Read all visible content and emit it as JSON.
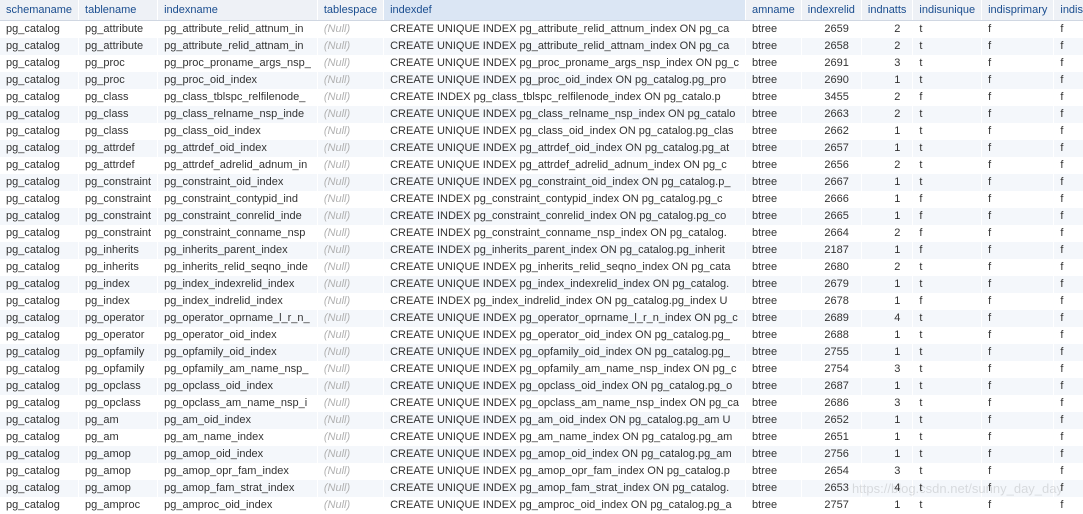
{
  "watermark": "https://blog.csdn.net/sunny_day_day",
  "columns": [
    {
      "key": "schemaname",
      "label": "schemaname",
      "sorted": false,
      "type": "text"
    },
    {
      "key": "tablename",
      "label": "tablename",
      "sorted": false,
      "type": "text"
    },
    {
      "key": "indexname",
      "label": "indexname",
      "sorted": false,
      "type": "text"
    },
    {
      "key": "tablespace",
      "label": "tablespace",
      "sorted": false,
      "type": "text"
    },
    {
      "key": "indexdef",
      "label": "indexdef",
      "sorted": true,
      "type": "text"
    },
    {
      "key": "amname",
      "label": "amname",
      "sorted": false,
      "type": "text"
    },
    {
      "key": "indexrelid",
      "label": "indexrelid",
      "sorted": false,
      "type": "num"
    },
    {
      "key": "indnatts",
      "label": "indnatts",
      "sorted": false,
      "type": "num"
    },
    {
      "key": "indisunique",
      "label": "indisunique",
      "sorted": false,
      "type": "text"
    },
    {
      "key": "indisprimary",
      "label": "indisprimary",
      "sorted": false,
      "type": "text"
    },
    {
      "key": "indisclustered",
      "label": "indisclu",
      "sorted": false,
      "type": "text"
    }
  ],
  "null_text": "(Null)",
  "rows": [
    {
      "schemaname": "pg_catalog",
      "tablename": "pg_attribute",
      "indexname": "pg_attribute_relid_attnum_in",
      "tablespace": null,
      "indexdef": "CREATE UNIQUE INDEX pg_attribute_relid_attnum_index ON pg_ca",
      "amname": "btree",
      "indexrelid": 2659,
      "indnatts": 2,
      "indisunique": "t",
      "indisprimary": "f",
      "indisclustered": "f"
    },
    {
      "schemaname": "pg_catalog",
      "tablename": "pg_attribute",
      "indexname": "pg_attribute_relid_attnam_in",
      "tablespace": null,
      "indexdef": "CREATE UNIQUE INDEX pg_attribute_relid_attnam_index ON pg_ca",
      "amname": "btree",
      "indexrelid": 2658,
      "indnatts": 2,
      "indisunique": "t",
      "indisprimary": "f",
      "indisclustered": "f"
    },
    {
      "schemaname": "pg_catalog",
      "tablename": "pg_proc",
      "indexname": "pg_proc_proname_args_nsp_",
      "tablespace": null,
      "indexdef": "CREATE UNIQUE INDEX pg_proc_proname_args_nsp_index ON pg_c",
      "amname": "btree",
      "indexrelid": 2691,
      "indnatts": 3,
      "indisunique": "t",
      "indisprimary": "f",
      "indisclustered": "f"
    },
    {
      "schemaname": "pg_catalog",
      "tablename": "pg_proc",
      "indexname": "pg_proc_oid_index",
      "tablespace": null,
      "indexdef": "CREATE UNIQUE INDEX pg_proc_oid_index ON pg_catalog.pg_pro",
      "amname": "btree",
      "indexrelid": 2690,
      "indnatts": 1,
      "indisunique": "t",
      "indisprimary": "f",
      "indisclustered": "f"
    },
    {
      "schemaname": "pg_catalog",
      "tablename": "pg_class",
      "indexname": "pg_class_tblspc_relfilenode_",
      "tablespace": null,
      "indexdef": "CREATE INDEX pg_class_tblspc_relfilenode_index ON pg_catalo.p",
      "amname": "btree",
      "indexrelid": 3455,
      "indnatts": 2,
      "indisunique": "f",
      "indisprimary": "f",
      "indisclustered": "f"
    },
    {
      "schemaname": "pg_catalog",
      "tablename": "pg_class",
      "indexname": "pg_class_relname_nsp_inde",
      "tablespace": null,
      "indexdef": "CREATE UNIQUE INDEX pg_class_relname_nsp_index ON pg_catalo",
      "amname": "btree",
      "indexrelid": 2663,
      "indnatts": 2,
      "indisunique": "t",
      "indisprimary": "f",
      "indisclustered": "f"
    },
    {
      "schemaname": "pg_catalog",
      "tablename": "pg_class",
      "indexname": "pg_class_oid_index",
      "tablespace": null,
      "indexdef": "CREATE UNIQUE INDEX pg_class_oid_index ON pg_catalog.pg_clas",
      "amname": "btree",
      "indexrelid": 2662,
      "indnatts": 1,
      "indisunique": "t",
      "indisprimary": "f",
      "indisclustered": "f"
    },
    {
      "schemaname": "pg_catalog",
      "tablename": "pg_attrdef",
      "indexname": "pg_attrdef_oid_index",
      "tablespace": null,
      "indexdef": "CREATE UNIQUE INDEX pg_attrdef_oid_index ON pg_catalog.pg_at",
      "amname": "btree",
      "indexrelid": 2657,
      "indnatts": 1,
      "indisunique": "t",
      "indisprimary": "f",
      "indisclustered": "f"
    },
    {
      "schemaname": "pg_catalog",
      "tablename": "pg_attrdef",
      "indexname": "pg_attrdef_adrelid_adnum_in",
      "tablespace": null,
      "indexdef": "CREATE UNIQUE INDEX pg_attrdef_adrelid_adnum_index ON pg_c",
      "amname": "btree",
      "indexrelid": 2656,
      "indnatts": 2,
      "indisunique": "t",
      "indisprimary": "f",
      "indisclustered": "f"
    },
    {
      "schemaname": "pg_catalog",
      "tablename": "pg_constraint",
      "indexname": "pg_constraint_oid_index",
      "tablespace": null,
      "indexdef": "CREATE UNIQUE INDEX pg_constraint_oid_index ON pg_catalog.p_",
      "amname": "btree",
      "indexrelid": 2667,
      "indnatts": 1,
      "indisunique": "t",
      "indisprimary": "f",
      "indisclustered": "f"
    },
    {
      "schemaname": "pg_catalog",
      "tablename": "pg_constraint",
      "indexname": "pg_constraint_contypid_ind",
      "tablespace": null,
      "indexdef": "CREATE INDEX pg_constraint_contypid_index ON pg_catalog.pg_c",
      "amname": "btree",
      "indexrelid": 2666,
      "indnatts": 1,
      "indisunique": "f",
      "indisprimary": "f",
      "indisclustered": "f"
    },
    {
      "schemaname": "pg_catalog",
      "tablename": "pg_constraint",
      "indexname": "pg_constraint_conrelid_inde",
      "tablespace": null,
      "indexdef": "CREATE INDEX pg_constraint_conrelid_index ON pg_catalog.pg_co",
      "amname": "btree",
      "indexrelid": 2665,
      "indnatts": 1,
      "indisunique": "f",
      "indisprimary": "f",
      "indisclustered": "f"
    },
    {
      "schemaname": "pg_catalog",
      "tablename": "pg_constraint",
      "indexname": "pg_constraint_conname_nsp",
      "tablespace": null,
      "indexdef": "CREATE INDEX pg_constraint_conname_nsp_index ON pg_catalog.",
      "amname": "btree",
      "indexrelid": 2664,
      "indnatts": 2,
      "indisunique": "f",
      "indisprimary": "f",
      "indisclustered": "f"
    },
    {
      "schemaname": "pg_catalog",
      "tablename": "pg_inherits",
      "indexname": "pg_inherits_parent_index",
      "tablespace": null,
      "indexdef": "CREATE INDEX pg_inherits_parent_index ON pg_catalog.pg_inherit",
      "amname": "btree",
      "indexrelid": 2187,
      "indnatts": 1,
      "indisunique": "f",
      "indisprimary": "f",
      "indisclustered": "f"
    },
    {
      "schemaname": "pg_catalog",
      "tablename": "pg_inherits",
      "indexname": "pg_inherits_relid_seqno_inde",
      "tablespace": null,
      "indexdef": "CREATE UNIQUE INDEX pg_inherits_relid_seqno_index ON pg_cata",
      "amname": "btree",
      "indexrelid": 2680,
      "indnatts": 2,
      "indisunique": "t",
      "indisprimary": "f",
      "indisclustered": "f"
    },
    {
      "schemaname": "pg_catalog",
      "tablename": "pg_index",
      "indexname": "pg_index_indexrelid_index",
      "tablespace": null,
      "indexdef": "CREATE UNIQUE INDEX pg_index_indexrelid_index ON pg_catalog.",
      "amname": "btree",
      "indexrelid": 2679,
      "indnatts": 1,
      "indisunique": "t",
      "indisprimary": "f",
      "indisclustered": "f"
    },
    {
      "schemaname": "pg_catalog",
      "tablename": "pg_index",
      "indexname": "pg_index_indrelid_index",
      "tablespace": null,
      "indexdef": "CREATE INDEX pg_index_indrelid_index ON pg_catalog.pg_index U",
      "amname": "btree",
      "indexrelid": 2678,
      "indnatts": 1,
      "indisunique": "f",
      "indisprimary": "f",
      "indisclustered": "f"
    },
    {
      "schemaname": "pg_catalog",
      "tablename": "pg_operator",
      "indexname": "pg_operator_oprname_l_r_n_",
      "tablespace": null,
      "indexdef": "CREATE UNIQUE INDEX pg_operator_oprname_l_r_n_index ON pg_c",
      "amname": "btree",
      "indexrelid": 2689,
      "indnatts": 4,
      "indisunique": "t",
      "indisprimary": "f",
      "indisclustered": "f"
    },
    {
      "schemaname": "pg_catalog",
      "tablename": "pg_operator",
      "indexname": "pg_operator_oid_index",
      "tablespace": null,
      "indexdef": "CREATE UNIQUE INDEX pg_operator_oid_index ON pg_catalog.pg_",
      "amname": "btree",
      "indexrelid": 2688,
      "indnatts": 1,
      "indisunique": "t",
      "indisprimary": "f",
      "indisclustered": "f"
    },
    {
      "schemaname": "pg_catalog",
      "tablename": "pg_opfamily",
      "indexname": "pg_opfamily_oid_index",
      "tablespace": null,
      "indexdef": "CREATE UNIQUE INDEX pg_opfamily_oid_index ON pg_catalog.pg_",
      "amname": "btree",
      "indexrelid": 2755,
      "indnatts": 1,
      "indisunique": "t",
      "indisprimary": "f",
      "indisclustered": "f"
    },
    {
      "schemaname": "pg_catalog",
      "tablename": "pg_opfamily",
      "indexname": "pg_opfamily_am_name_nsp_",
      "tablespace": null,
      "indexdef": "CREATE UNIQUE INDEX pg_opfamily_am_name_nsp_index ON pg_c",
      "amname": "btree",
      "indexrelid": 2754,
      "indnatts": 3,
      "indisunique": "t",
      "indisprimary": "f",
      "indisclustered": "f"
    },
    {
      "schemaname": "pg_catalog",
      "tablename": "pg_opclass",
      "indexname": "pg_opclass_oid_index",
      "tablespace": null,
      "indexdef": "CREATE UNIQUE INDEX pg_opclass_oid_index ON pg_catalog.pg_o",
      "amname": "btree",
      "indexrelid": 2687,
      "indnatts": 1,
      "indisunique": "t",
      "indisprimary": "f",
      "indisclustered": "f"
    },
    {
      "schemaname": "pg_catalog",
      "tablename": "pg_opclass",
      "indexname": "pg_opclass_am_name_nsp_i",
      "tablespace": null,
      "indexdef": "CREATE UNIQUE INDEX pg_opclass_am_name_nsp_index ON pg_ca",
      "amname": "btree",
      "indexrelid": 2686,
      "indnatts": 3,
      "indisunique": "t",
      "indisprimary": "f",
      "indisclustered": "f"
    },
    {
      "schemaname": "pg_catalog",
      "tablename": "pg_am",
      "indexname": "pg_am_oid_index",
      "tablespace": null,
      "indexdef": "CREATE UNIQUE INDEX pg_am_oid_index ON pg_catalog.pg_am U",
      "amname": "btree",
      "indexrelid": 2652,
      "indnatts": 1,
      "indisunique": "t",
      "indisprimary": "f",
      "indisclustered": "f"
    },
    {
      "schemaname": "pg_catalog",
      "tablename": "pg_am",
      "indexname": "pg_am_name_index",
      "tablespace": null,
      "indexdef": "CREATE UNIQUE INDEX pg_am_name_index ON pg_catalog.pg_am",
      "amname": "btree",
      "indexrelid": 2651,
      "indnatts": 1,
      "indisunique": "t",
      "indisprimary": "f",
      "indisclustered": "f"
    },
    {
      "schemaname": "pg_catalog",
      "tablename": "pg_amop",
      "indexname": "pg_amop_oid_index",
      "tablespace": null,
      "indexdef": "CREATE UNIQUE INDEX pg_amop_oid_index ON pg_catalog.pg_am",
      "amname": "btree",
      "indexrelid": 2756,
      "indnatts": 1,
      "indisunique": "t",
      "indisprimary": "f",
      "indisclustered": "f"
    },
    {
      "schemaname": "pg_catalog",
      "tablename": "pg_amop",
      "indexname": "pg_amop_opr_fam_index",
      "tablespace": null,
      "indexdef": "CREATE UNIQUE INDEX pg_amop_opr_fam_index ON pg_catalog.p",
      "amname": "btree",
      "indexrelid": 2654,
      "indnatts": 3,
      "indisunique": "t",
      "indisprimary": "f",
      "indisclustered": "f"
    },
    {
      "schemaname": "pg_catalog",
      "tablename": "pg_amop",
      "indexname": "pg_amop_fam_strat_index",
      "tablespace": null,
      "indexdef": "CREATE UNIQUE INDEX pg_amop_fam_strat_index ON pg_catalog.",
      "amname": "btree",
      "indexrelid": 2653,
      "indnatts": 4,
      "indisunique": "t",
      "indisprimary": "f",
      "indisclustered": "f"
    },
    {
      "schemaname": "pg_catalog",
      "tablename": "pg_amproc",
      "indexname": "pg_amproc_oid_index",
      "tablespace": null,
      "indexdef": "CREATE UNIQUE INDEX pg_amproc_oid_index ON pg_catalog.pg_a",
      "amname": "btree",
      "indexrelid": 2757,
      "indnatts": 1,
      "indisunique": "t",
      "indisprimary": "f",
      "indisclustered": "f"
    }
  ]
}
